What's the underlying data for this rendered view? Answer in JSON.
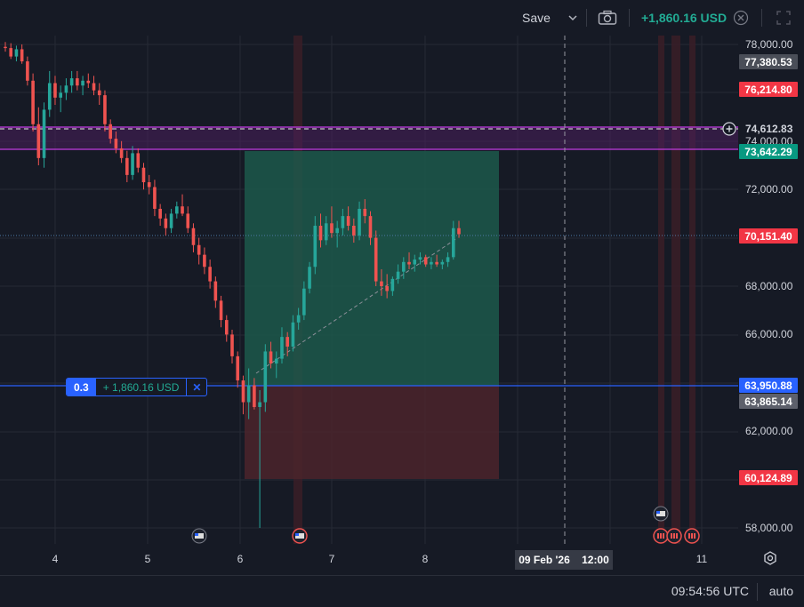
{
  "toolbar": {
    "save_label": "Save",
    "pnl_label": "+1,860.16 USD",
    "icons": [
      "chevron-down-icon",
      "camera-icon",
      "close-circle-icon",
      "fullscreen-icon"
    ]
  },
  "colors": {
    "background": "#161a25",
    "bull": "#26a69a",
    "bear": "#ef5350",
    "profit_zone": "#1e5a4c",
    "loss_zone": "#4a2429",
    "band": "#7b1fa2",
    "blue_line": "#2962ff"
  },
  "price_labels": {
    "p77380": "77,380.53",
    "p76214": "76,214.80",
    "p74612": "74,612.83",
    "p73642": "73,642.29",
    "p70151": "70,151.40",
    "p63950": "63,950.88",
    "p63865": "63,865.14",
    "p60124": "60,124.89"
  },
  "order": {
    "qty": "0.3",
    "pnl": "+ 1,860.16 USD",
    "close": "✕"
  },
  "time_axis": {
    "crosshair": "09 Feb '26    12:00"
  },
  "status": {
    "clock": "09:54:56 UTC",
    "scale_mode": "auto"
  },
  "chart_data": {
    "type": "candlestick",
    "y_ticks": [
      "78,000.00",
      "74,000.00",
      "72,000.00",
      "68,000.00",
      "66,000.00",
      "62,000.00",
      "58,000.00"
    ],
    "y_tick_values": [
      78000,
      74000,
      72000,
      68000,
      66000,
      62000,
      58000
    ],
    "x_ticks": [
      "4",
      "5",
      "6",
      "7",
      "8",
      "11"
    ],
    "ylim": [
      57500,
      78500
    ],
    "grid": true,
    "position": {
      "side": "long",
      "entry": 63950.88,
      "take_profit": 73642.29,
      "stop_loss": 60124.89
    },
    "horizontal_levels": [
      77380.53,
      76214.8,
      74612.83,
      73642.29,
      70151.4,
      63950.88,
      63865.14,
      60124.89
    ],
    "candles": [
      [
        77900,
        78100,
        77700,
        77850
      ],
      [
        77850,
        78050,
        77400,
        77500
      ],
      [
        77500,
        77950,
        77300,
        77800
      ],
      [
        77800,
        78000,
        77200,
        77300
      ],
      [
        77300,
        77500,
        76300,
        76500
      ],
      [
        76500,
        76800,
        74400,
        74700
      ],
      [
        74700,
        75400,
        73000,
        73300
      ],
      [
        73300,
        75600,
        72900,
        75300
      ],
      [
        75300,
        76900,
        75000,
        76400
      ],
      [
        76400,
        76700,
        75500,
        75800
      ],
      [
        75800,
        76300,
        75200,
        76000
      ],
      [
        76000,
        76600,
        75700,
        76300
      ],
      [
        76300,
        76900,
        76000,
        76600
      ],
      [
        76600,
        76900,
        76100,
        76300
      ],
      [
        76300,
        76700,
        75900,
        76500
      ],
      [
        76500,
        76800,
        76200,
        76400
      ],
      [
        76400,
        76700,
        75900,
        76100
      ],
      [
        76100,
        76400,
        75500,
        75900
      ],
      [
        75900,
        76100,
        74400,
        74700
      ],
      [
        74700,
        74900,
        73900,
        74100
      ],
      [
        74100,
        74400,
        73500,
        73700
      ],
      [
        73700,
        74000,
        73100,
        73300
      ],
      [
        73300,
        73600,
        72300,
        72600
      ],
      [
        72600,
        73800,
        72400,
        73500
      ],
      [
        73500,
        73700,
        72700,
        72900
      ],
      [
        72900,
        73100,
        72000,
        72300
      ],
      [
        72300,
        72600,
        71800,
        72100
      ],
      [
        72100,
        72400,
        70900,
        71200
      ],
      [
        71200,
        71400,
        70500,
        70800
      ],
      [
        70800,
        71000,
        70100,
        70400
      ],
      [
        70400,
        71200,
        70200,
        71000
      ],
      [
        71000,
        71500,
        70800,
        71300
      ],
      [
        71300,
        71800,
        70900,
        71000
      ],
      [
        71000,
        71300,
        70200,
        70400
      ],
      [
        70400,
        70600,
        69400,
        69700
      ],
      [
        69700,
        70000,
        68900,
        69300
      ],
      [
        69300,
        69600,
        68500,
        68800
      ],
      [
        68800,
        69100,
        67900,
        68200
      ],
      [
        68200,
        68400,
        67100,
        67400
      ],
      [
        67400,
        67600,
        66300,
        66600
      ],
      [
        66600,
        66800,
        65700,
        66000
      ],
      [
        66000,
        66200,
        64800,
        65100
      ],
      [
        65100,
        65300,
        63800,
        64100
      ],
      [
        64100,
        64300,
        62700,
        63200
      ],
      [
        63200,
        64600,
        62500,
        63900
      ],
      [
        63900,
        64200,
        62900,
        63000
      ],
      [
        63000,
        63700,
        58000,
        63200
      ],
      [
        63200,
        65600,
        62800,
        65300
      ],
      [
        65300,
        65700,
        64600,
        64800
      ],
      [
        64800,
        65300,
        64200,
        65000
      ],
      [
        65000,
        66300,
        64800,
        65900
      ],
      [
        65900,
        66100,
        65100,
        65500
      ],
      [
        65500,
        66800,
        65300,
        66500
      ],
      [
        66500,
        67100,
        66200,
        66800
      ],
      [
        66800,
        68200,
        66600,
        67900
      ],
      [
        67900,
        69000,
        67700,
        68800
      ],
      [
        68800,
        70900,
        68500,
        70500
      ],
      [
        70500,
        71000,
        69600,
        69900
      ],
      [
        69900,
        70900,
        69700,
        70600
      ],
      [
        70600,
        71300,
        70000,
        70200
      ],
      [
        70200,
        70700,
        69600,
        70400
      ],
      [
        70400,
        71200,
        70100,
        70900
      ],
      [
        70900,
        71300,
        70300,
        70500
      ],
      [
        70500,
        70800,
        69800,
        70100
      ],
      [
        70100,
        71500,
        69900,
        71200
      ],
      [
        71200,
        71600,
        70600,
        70900
      ],
      [
        70900,
        71100,
        69700,
        70000
      ],
      [
        70000,
        70300,
        68000,
        68200
      ],
      [
        68200,
        68700,
        67600,
        68000
      ],
      [
        68000,
        68500,
        67500,
        67800
      ],
      [
        67800,
        68400,
        67600,
        68300
      ],
      [
        68300,
        68900,
        68100,
        68600
      ],
      [
        68600,
        69200,
        68300,
        69000
      ],
      [
        69000,
        69400,
        68700,
        68900
      ],
      [
        68900,
        69300,
        68600,
        69100
      ],
      [
        69100,
        69400,
        68900,
        69200
      ],
      [
        69200,
        69300,
        68800,
        68900
      ],
      [
        68900,
        69200,
        68700,
        69000
      ],
      [
        69000,
        69300,
        68800,
        68900
      ],
      [
        68900,
        69100,
        68700,
        69000
      ],
      [
        69000,
        69400,
        68800,
        69200
      ],
      [
        69200,
        70700,
        69100,
        70400
      ],
      [
        70400,
        70700,
        70000,
        70150
      ]
    ]
  }
}
